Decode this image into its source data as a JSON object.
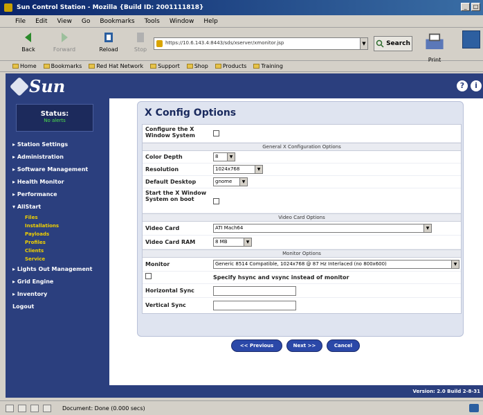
{
  "window": {
    "title": "Sun Control Station - Mozilla {Build ID: 2001111818}"
  },
  "menu": [
    "File",
    "Edit",
    "View",
    "Go",
    "Bookmarks",
    "Tools",
    "Window",
    "Help"
  ],
  "toolbar": {
    "back_label": "Back",
    "forward_label": "Forward",
    "reload_label": "Reload",
    "stop_label": "Stop",
    "url": "https://10.6.143.4:8443/sds/xserver/xmonitor.jsp",
    "search_label": "Search",
    "print_label": "Print"
  },
  "personal_toolbar": [
    "Home",
    "Bookmarks",
    "Red Hat Network",
    "Support",
    "Shop",
    "Products",
    "Training"
  ],
  "sun_header": {
    "logo_text": "Sun",
    "help_label": "?",
    "info_label": "i"
  },
  "sidebar": {
    "status_title": "Status:",
    "status_value": "No alerts",
    "items": [
      "Station Settings",
      "Administration",
      "Software Management",
      "Health Monitor",
      "Performance",
      "AllStart"
    ],
    "subitems": [
      "Files",
      "Installations",
      "Payloads",
      "Profiles",
      "Clients",
      "Service"
    ],
    "items_after": [
      "Lights Out Management",
      "Grid Engine",
      "Inventory"
    ],
    "logout": "Logout"
  },
  "panel": {
    "title": "X Config Options",
    "configure_label": "Configure the X Window System",
    "general_section": "General X Configuration Options",
    "color_depth_label": "Color Depth",
    "color_depth_value": "8",
    "resolution_label": "Resolution",
    "resolution_value": "1024x768",
    "default_desktop_label": "Default Desktop",
    "default_desktop_value": "gnome",
    "start_x_label": "Start the X Window System on boot",
    "video_section": "Video Card Options",
    "video_card_label": "Video Card",
    "video_card_value": "ATI Mach64",
    "video_ram_label": "Video Card RAM",
    "video_ram_value": "8 MB",
    "monitor_section": "Monitor Options",
    "monitor_label": "Monitor",
    "monitor_value": "Generic 8514 Compatible, 1024x768 @ 87 Hz Interlaced (no 800x600)",
    "specify_sync_label": "Specify hsync and vsync instead of monitor",
    "hsync_label": "Horizontal Sync",
    "vsync_label": "Vertical Sync"
  },
  "buttons": {
    "previous": "<< Previous",
    "next": "Next >>",
    "cancel": "Cancel"
  },
  "version": "Version: 2.0 Build 2-8-31",
  "statusbar": {
    "text": "Document: Done (0.000 secs)"
  }
}
